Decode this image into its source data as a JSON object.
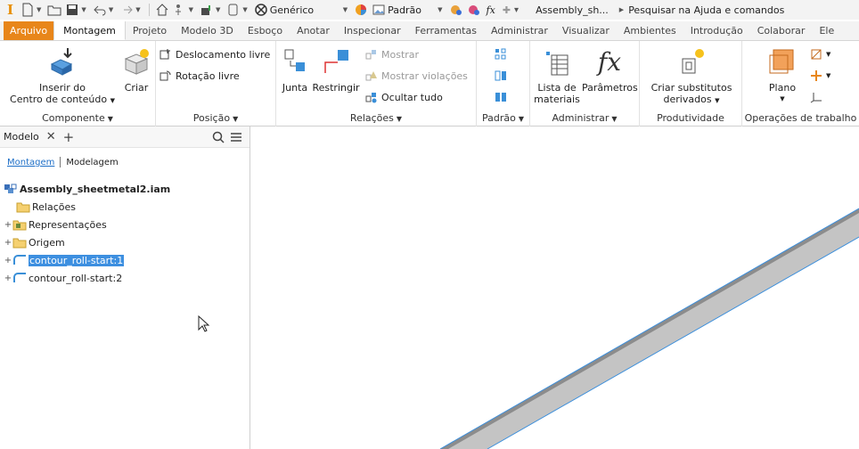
{
  "qat": {
    "material": "Genérico",
    "appearance": "Padrão",
    "document_name": "Assembly_sh...",
    "help_search": "Pesquisar na Ajuda e comandos"
  },
  "tabs": [
    "Arquivo",
    "Montagem",
    "Projeto",
    "Modelo 3D",
    "Esboço",
    "Anotar",
    "Inspecionar",
    "Ferramentas",
    "Administrar",
    "Visualizar",
    "Ambientes",
    "Introdução",
    "Colaborar",
    "Ele"
  ],
  "active_tab": "Montagem",
  "ribbon": {
    "componente": {
      "title": "Componente",
      "inserir_line1": "Inserir do",
      "inserir_line2": "Centro de conteúdo",
      "criar": "Criar"
    },
    "posicao": {
      "title": "Posição",
      "deslocamento": "Deslocamento livre",
      "rotacao": "Rotação livre"
    },
    "relacoes": {
      "title": "Relações",
      "junta": "Junta",
      "restringir": "Restringir",
      "mostrar": "Mostrar",
      "mostrar_violacoes": "Mostrar violações",
      "ocultar_tudo": "Ocultar tudo"
    },
    "padrao": {
      "title": "Padrão"
    },
    "administrar": {
      "title": "Administrar",
      "lista_line1": "Lista de",
      "lista_line2": "materiais",
      "parametros": "Parâmetros"
    },
    "produtividade": {
      "title": "Produtividade",
      "criar_line1": "Criar substitutos",
      "criar_line2": "derivados"
    },
    "operacoes": {
      "title": "Operações de trabalho",
      "plano": "Plano"
    }
  },
  "browser": {
    "title": "Modelo",
    "subtab_active": "Montagem",
    "subtab_other": "Modelagem",
    "root": "Assembly_sheetmetal2.iam",
    "items": [
      "Relações",
      "Representações",
      "Origem",
      "contour_roll-start:1",
      "contour_roll-start:2"
    ],
    "selected_item": "contour_roll-start:1"
  },
  "colors": {
    "accent_orange": "#e8861a",
    "selection_blue": "#3d8fe0",
    "part_gray": "#c4c4c4",
    "edge_blue": "#3c8fdc"
  }
}
